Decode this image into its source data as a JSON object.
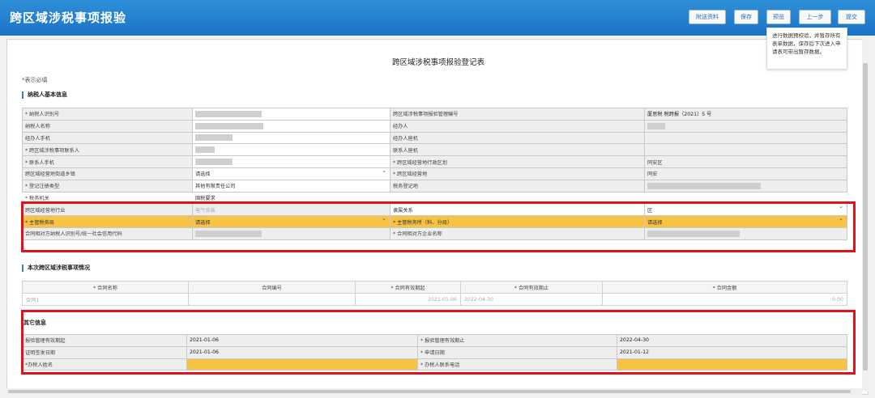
{
  "app_title": "跨区域涉税事项报验",
  "toolbar": {
    "buttons": [
      {
        "label": "附送资料"
      },
      {
        "label": "保存"
      },
      {
        "label": "预览"
      },
      {
        "label": "上一步"
      },
      {
        "label": "提交"
      }
    ],
    "tooltip": "进行数据预校验，并暂存所有表单数据，保存后下次进入申请表可带出暂存数据。"
  },
  "form": {
    "title": "跨区域涉税事项报验登记表",
    "required_note": "*表示必填"
  },
  "taxpayer": {
    "section_title": "纳税人基本信息",
    "rows": [
      {
        "l1": "* 纳税人识别号",
        "v1": "",
        "l2": "跨区域涉税事项报验管理编号",
        "v2": "厦思税 税跨报（2021）5 号"
      },
      {
        "l1": "纳税人名称",
        "v1": "",
        "l2": "经办人",
        "v2": ""
      },
      {
        "l1": "经办人手机",
        "v1": "",
        "l2": "经办人座机",
        "v2": ""
      },
      {
        "l1": "* 跨区域涉税事项联系人",
        "v1": "",
        "l2": "联系人座机",
        "v2": ""
      },
      {
        "l1": "* 联系人手机",
        "v1": "",
        "l2": "* 跨区域经营地行政区划",
        "v2": "同安区"
      },
      {
        "l1": "跨区域经营地街道乡镇",
        "v1": "请选择",
        "l2": "* 跨区域经营地",
        "v2": "同安"
      },
      {
        "l1": "* 登记注册类型",
        "v1": "其他有限责任公司",
        "l2": "税务登记地",
        "v2": ""
      },
      {
        "l1": "* 税务机关",
        "v1": "国税要求",
        "l2": "",
        "v2": ""
      },
      {
        "l1": "跨区域经营地行业",
        "v1": "电气安装",
        "l2": "隶属关系",
        "v2": "区"
      },
      {
        "l1": "* 主管税务局",
        "v1": "请选择",
        "l2": "* 主管税务所（科、分局）",
        "v2": "请选择"
      },
      {
        "l1": "合同相对方纳税人识别号/统一社会信用代码",
        "v1": "",
        "l2": "* 合同相对方企业名称",
        "v2": ""
      }
    ]
  },
  "contract": {
    "section_title": "本次跨区域涉税事项情况",
    "headers": [
      "* 合同名称",
      "合同编号",
      "* 合同有效期起",
      "* 合同有效期止",
      "* 合同金额"
    ],
    "row": [
      "合同1",
      "",
      "2021-01-06",
      "2022-04-30",
      "0.00"
    ]
  },
  "other": {
    "section_title": "其它信息",
    "rows": [
      {
        "l1": "报验管理有效期起",
        "v1": "2021-01-06",
        "l2": "* 报验管理有效期止",
        "v2": "2022-04-30"
      },
      {
        "l1": "证明签发日期",
        "v1": "2021-01-06",
        "l2": "* 申请日期",
        "v2": "2021-01-12"
      },
      {
        "l1": "*办税人姓名",
        "v1": "",
        "l2": "* 办税人联系电话",
        "v2": ""
      }
    ]
  },
  "colors": {
    "header": "#1f7ccc",
    "highlight": "#f6c344",
    "redbox": "#e0121a"
  }
}
